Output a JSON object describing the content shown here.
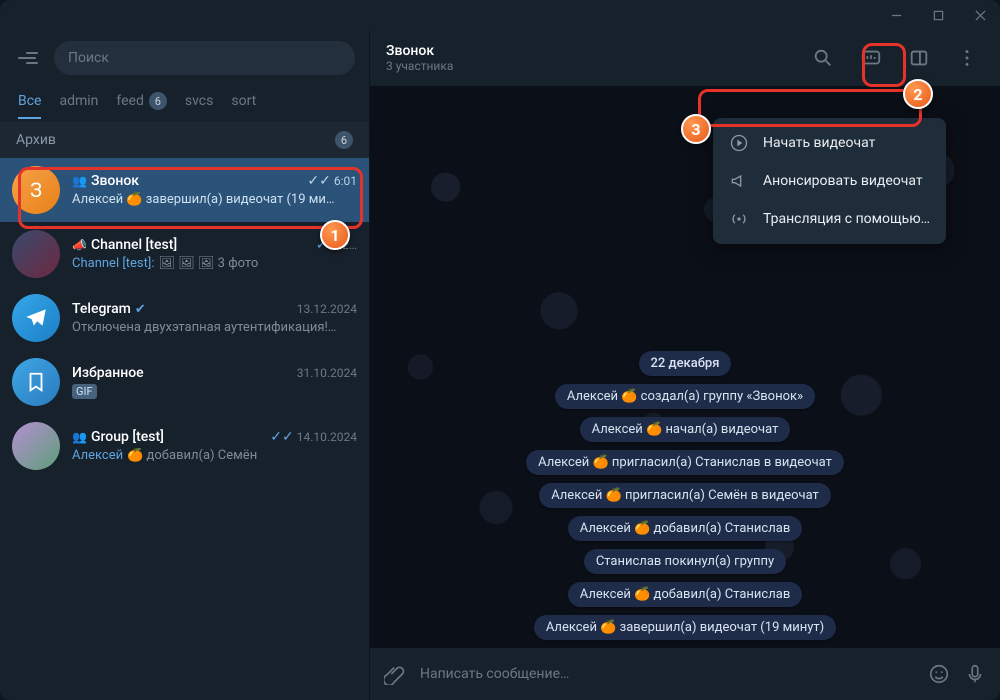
{
  "window": {
    "min": "—",
    "max": "▢",
    "close": "✕"
  },
  "sidebar": {
    "search_placeholder": "Поиск",
    "folders": [
      {
        "label": "Все",
        "active": true
      },
      {
        "label": "admin"
      },
      {
        "label": "feed",
        "badge": "6"
      },
      {
        "label": "svcs"
      },
      {
        "label": "sort"
      }
    ],
    "archive": {
      "label": "Архив",
      "badge": "6"
    }
  },
  "chats": [
    {
      "avatar_letter": "З",
      "avatar_class": "av-orange",
      "icon": "group",
      "name": "Звонок",
      "meta_check": "✓✓",
      "meta": "6:01",
      "snippet": "Алексей 🍊 завершил(а) видеочат (19 ми…",
      "selected": true
    },
    {
      "avatar_class": "av-img1",
      "icon": "megaphone",
      "name": "Channel [test]",
      "meta_check": "✓✓",
      "meta": "2…",
      "snippet_prefix": "Channel [test]:",
      "snippet": "🖼 🖼 🖼  3 фото"
    },
    {
      "avatar_class": "av-tg",
      "avatar_svg": "telegram",
      "name": "Telegram",
      "verified": true,
      "meta": "13.12.2024",
      "snippet": "Отключена двухэтапная аутентификация!…"
    },
    {
      "avatar_class": "av-saved",
      "avatar_svg": "bookmark",
      "name": "Избранное",
      "meta": "31.10.2024",
      "snippet_badge": "GIF"
    },
    {
      "avatar_class": "av-grp",
      "icon": "group",
      "name": "Group [test]",
      "meta_check": "✓✓",
      "meta": "14.10.2024",
      "snippet": "Алексей 🍊 добавил(а) Семён"
    }
  ],
  "main": {
    "title": "Звонок",
    "subtitle": "3 участника"
  },
  "dropdown": [
    {
      "icon": "play",
      "label": "Начать видеочат"
    },
    {
      "icon": "megaphone",
      "label": "Анонсировать видеочат"
    },
    {
      "icon": "broadcast",
      "label": "Трансляция с помощью…"
    }
  ],
  "date": "22 декабря",
  "system_messages": [
    "Алексей 🍊 создал(а) группу «Звонок»",
    "Алексей 🍊 начал(а) видеочат",
    "Алексей 🍊 пригласил(а) Станислав в видеочат",
    "Алексей 🍊 пригласил(а) Семён в видеочат",
    "Алексей 🍊 добавил(а) Станислав",
    "Станислав покинул(а) группу",
    "Алексей 🍊 добавил(а) Станислав",
    "Алексей 🍊 завершил(а) видеочат (19 минут)"
  ],
  "input": {
    "placeholder": "Написать сообщение…"
  },
  "steps": {
    "s1": "1",
    "s2": "2",
    "s3": "3"
  }
}
